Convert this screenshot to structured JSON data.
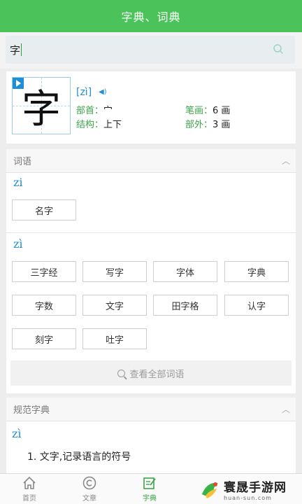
{
  "header": {
    "title": "字典、词典"
  },
  "search": {
    "value": "字"
  },
  "char": {
    "glyph": "字",
    "pinyin": "[zì]",
    "radical_label": "部首：",
    "radical_value": "宀",
    "strokes_label": "笔画：",
    "strokes_value": "6 画",
    "structure_label": "结构：",
    "structure_value": "上下",
    "outer_label": "部外：",
    "outer_value": "3 画"
  },
  "words_section": {
    "title": "词语",
    "groups": [
      {
        "pinyin": "zi",
        "words": [
          "名字"
        ]
      },
      {
        "pinyin": "zì",
        "words": [
          "三字经",
          "写字",
          "字体",
          "字典",
          "字数",
          "文字",
          "田字格",
          "认字",
          "刻字",
          "吐字"
        ]
      }
    ],
    "view_all": "查看全部词语"
  },
  "standard_section": {
    "title": "规范字典",
    "pinyin": "zì",
    "definition": "1. 文字,记录语言的符号"
  },
  "tabbar": {
    "tabs": [
      {
        "label": "首页",
        "icon": "home-icon"
      },
      {
        "label": "文章",
        "icon": "copyright-icon"
      },
      {
        "label": "字典",
        "icon": "edit-icon",
        "active": true
      }
    ]
  },
  "watermark": {
    "main": "寰晟手游网",
    "sub": "huan-sun.com"
  },
  "colors": {
    "accent": "#4cc35a",
    "link": "#1d8ed8",
    "label_green": "#3aa648"
  }
}
